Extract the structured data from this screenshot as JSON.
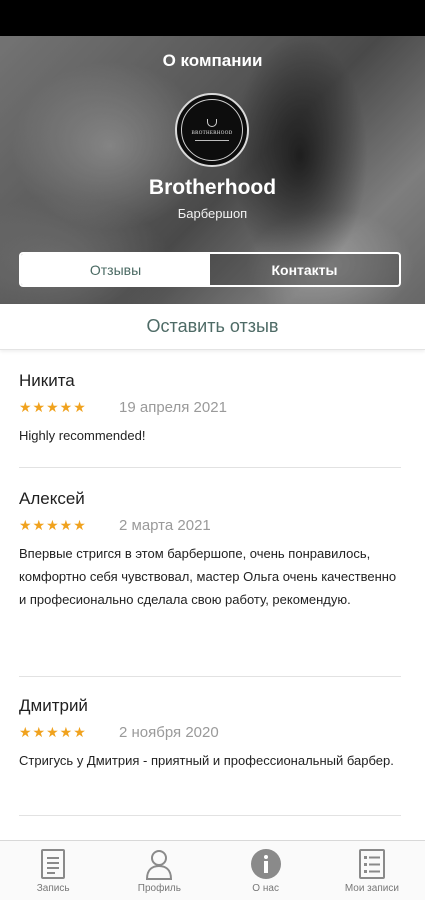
{
  "header": {
    "title": "О компании",
    "logo_text": "BROTHERHOOD",
    "company_name": "Brotherhood",
    "company_type": "Барбершоп"
  },
  "tabs": [
    {
      "label": "Отзывы",
      "active": true
    },
    {
      "label": "Контакты",
      "active": false
    }
  ],
  "leave_review_label": "Оставить отзыв",
  "reviews": [
    {
      "name": "Никита",
      "rating": 5,
      "stars": "★★★★★",
      "date": "19 апреля 2021",
      "text": "Highly recommended!"
    },
    {
      "name": "Алексей",
      "rating": 5,
      "stars": "★★★★★",
      "date": "2 марта 2021",
      "text": "Впервые стригся в этом барбершопе, очень понравилось, комфортно себя чувствовал, мастер Ольга очень качественно и професионально сделала свою работу, рекомендую."
    },
    {
      "name": "Дмитрий",
      "rating": 5,
      "stars": "★★★★★",
      "date": "2 ноября 2020",
      "text": "Стригусь у Дмитрия - приятный и профессиональный барбер."
    }
  ],
  "bottom_nav": [
    {
      "label": "Запись",
      "icon": "document-icon"
    },
    {
      "label": "Профиль",
      "icon": "person-icon"
    },
    {
      "label": "О нас",
      "icon": "info-icon"
    },
    {
      "label": "Мои записи",
      "icon": "list-icon"
    }
  ],
  "colors": {
    "accent": "#4e6b66",
    "star": "#f0a21e",
    "nav_icon": "#8a8a8a"
  }
}
